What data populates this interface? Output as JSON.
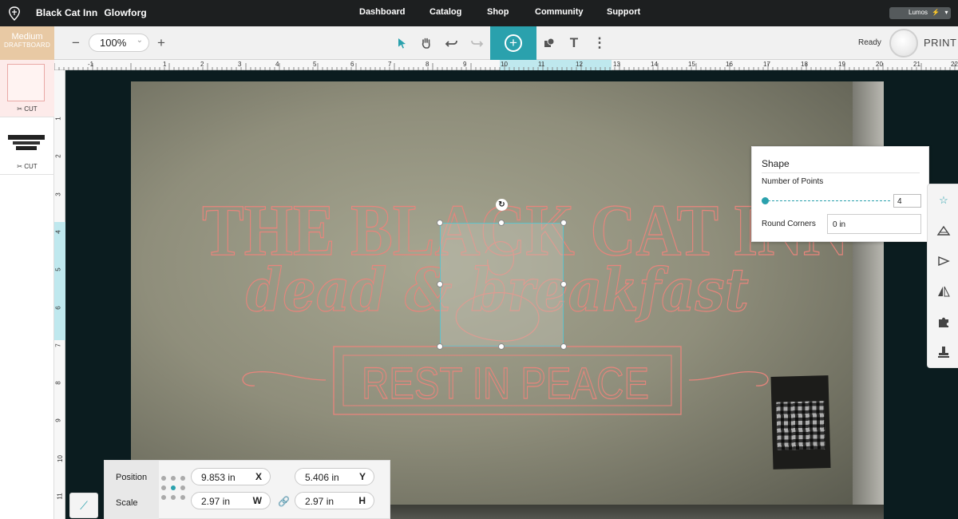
{
  "nav": {
    "title_part1": "Black Cat Inn",
    "title_part2": "Glowforg",
    "links": [
      "Dashboard",
      "Catalog",
      "Shop",
      "Community",
      "Support"
    ],
    "user": "Lumos"
  },
  "toolbar": {
    "material_name": "Medium",
    "material_type": "DRAFTBOARD",
    "zoom": "100%",
    "zoom_out": "−",
    "zoom_in": "+",
    "status": "Ready",
    "print_label": "PRINT",
    "add_symbol": "+"
  },
  "thumbnails": [
    {
      "label": "CUT"
    },
    {
      "label": "CUT"
    }
  ],
  "ruler_h": [
    "-1",
    "1",
    "2",
    "3",
    "4",
    "5",
    "6",
    "7",
    "8",
    "9",
    "10",
    "11",
    "12",
    "13",
    "14",
    "15",
    "16",
    "17",
    "18",
    "19",
    "20",
    "21",
    "22"
  ],
  "ruler_v": [
    "1",
    "2",
    "3",
    "4",
    "5",
    "6",
    "7",
    "8",
    "9",
    "10",
    "11"
  ],
  "artwork": {
    "line1": "THE BLACK CAT INN",
    "line2": "dead & breakfast",
    "line3": "REST IN PEACE",
    "stroke_color": "#e8857c",
    "thumb_text": "THE BLACK CAT INN"
  },
  "shape_panel": {
    "heading": "Shape",
    "points_label": "Number of Points",
    "points_value": "4",
    "points_fraction": 0.0,
    "corners_label": "Round Corners",
    "corners_value": "0 in"
  },
  "position_panel": {
    "position_label": "Position",
    "scale_label": "Scale",
    "x_value": "9.853 in",
    "x_axis": "X",
    "y_value": "5.406 in",
    "y_axis": "Y",
    "w_value": "2.97 in",
    "w_axis": "W",
    "h_value": "2.97 in",
    "h_axis": "H"
  },
  "colors": {
    "accent": "#2aa1ad",
    "topnav": "#1d1f20",
    "material": "#e8c9a4"
  },
  "icons": [
    "logo-icon",
    "select-arrow-icon",
    "hand-icon",
    "undo-icon",
    "redo-icon",
    "add-icon",
    "shapes-icon",
    "text-icon",
    "more-icon",
    "star-icon",
    "align-icon",
    "flip-icon",
    "mirror-icon",
    "puzzle-icon",
    "stamp-icon",
    "link-icon",
    "ruler-icon",
    "rotate-icon"
  ]
}
